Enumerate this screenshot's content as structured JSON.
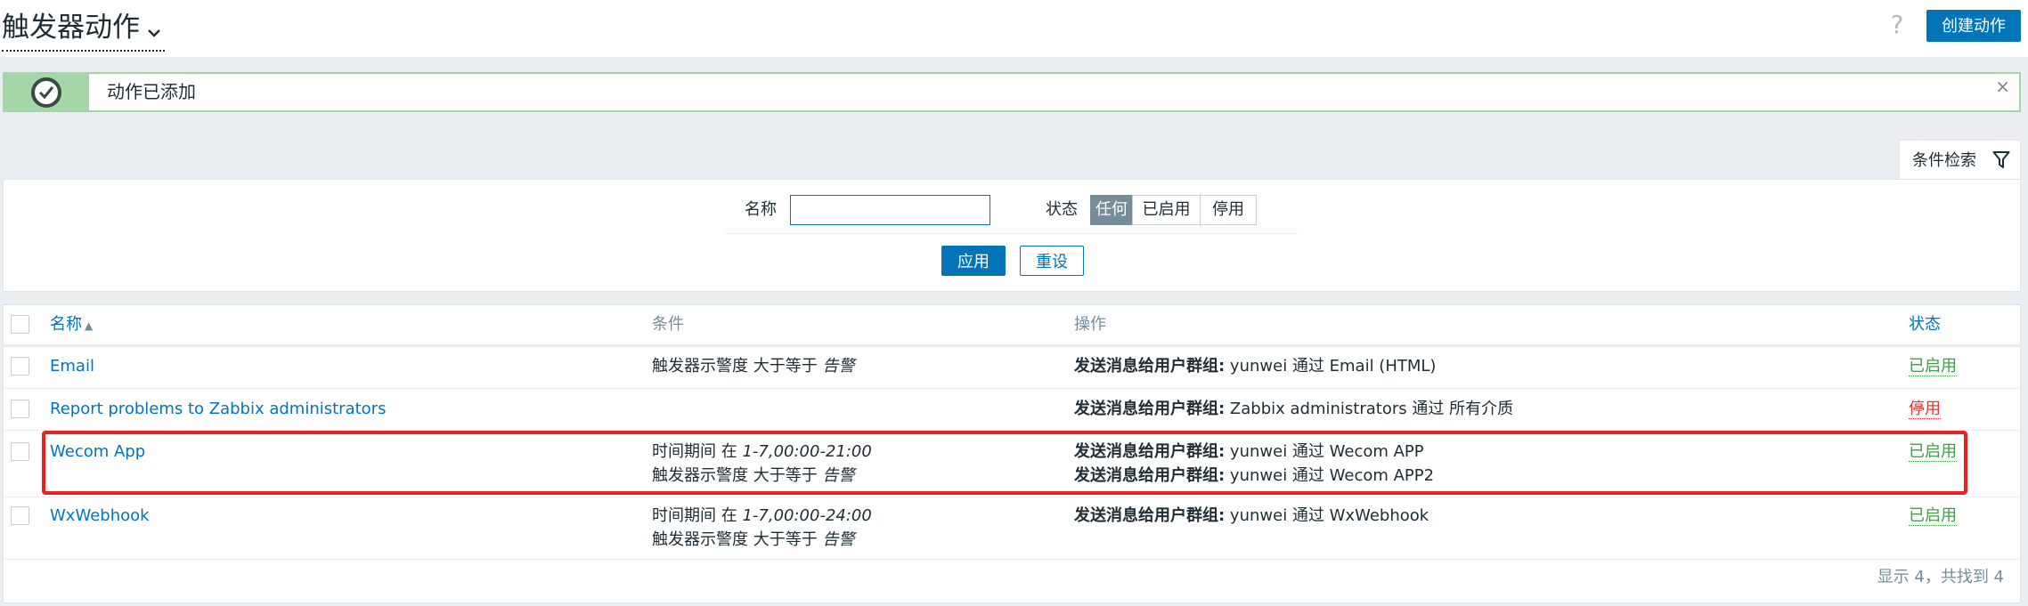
{
  "header": {
    "title": "触发器动作",
    "help_icon": "?",
    "create_button": "创建动作"
  },
  "message": {
    "text": "动作已添加",
    "close": "×"
  },
  "filter": {
    "tab_label": "条件检索",
    "name_label": "名称",
    "name_value": "",
    "status_label": "状态",
    "status_options": [
      "任何",
      "已启用",
      "停用"
    ],
    "status_selected": "任何",
    "apply": "应用",
    "reset": "重设"
  },
  "table": {
    "columns": {
      "name": "名称",
      "conditions": "条件",
      "operations": "操作",
      "status": "状态"
    },
    "rows": [
      {
        "name": "Email",
        "conditions": [
          {
            "prefix": "触发器示警度 大于等于 ",
            "value": "告警"
          }
        ],
        "operations": [
          {
            "label": "发送消息给用户群组:",
            "text": " yunwei 通过 Email (HTML)"
          }
        ],
        "status": "已启用"
      },
      {
        "name": "Report problems to Zabbix administrators",
        "conditions": [],
        "operations": [
          {
            "label": "发送消息给用户群组:",
            "text": " Zabbix administrators 通过 所有介质"
          }
        ],
        "status": "停用"
      },
      {
        "name": "Wecom App",
        "conditions": [
          {
            "prefix": "时间期间 在 ",
            "value": "1-7,00:00-21:00"
          },
          {
            "prefix": "触发器示警度 大于等于 ",
            "value": "告警"
          }
        ],
        "operations": [
          {
            "label": "发送消息给用户群组:",
            "text": " yunwei 通过 Wecom APP"
          },
          {
            "label": "发送消息给用户群组:",
            "text": " yunwei 通过 Wecom APP2"
          }
        ],
        "status": "已启用"
      },
      {
        "name": "WxWebhook",
        "conditions": [
          {
            "prefix": "时间期间 在 ",
            "value": "1-7,00:00-24:00"
          },
          {
            "prefix": "触发器示警度 大于等于 ",
            "value": "告警"
          }
        ],
        "operations": [
          {
            "label": "发送消息给用户群组:",
            "text": " yunwei 通过 WxWebhook"
          }
        ],
        "status": "已启用"
      }
    ],
    "paging": "显示 4，共找到 4"
  },
  "colors": {
    "accent": "#0275b8",
    "status_enabled": "#429e47",
    "status_disabled": "#e33734",
    "highlight": "#e8221c"
  }
}
